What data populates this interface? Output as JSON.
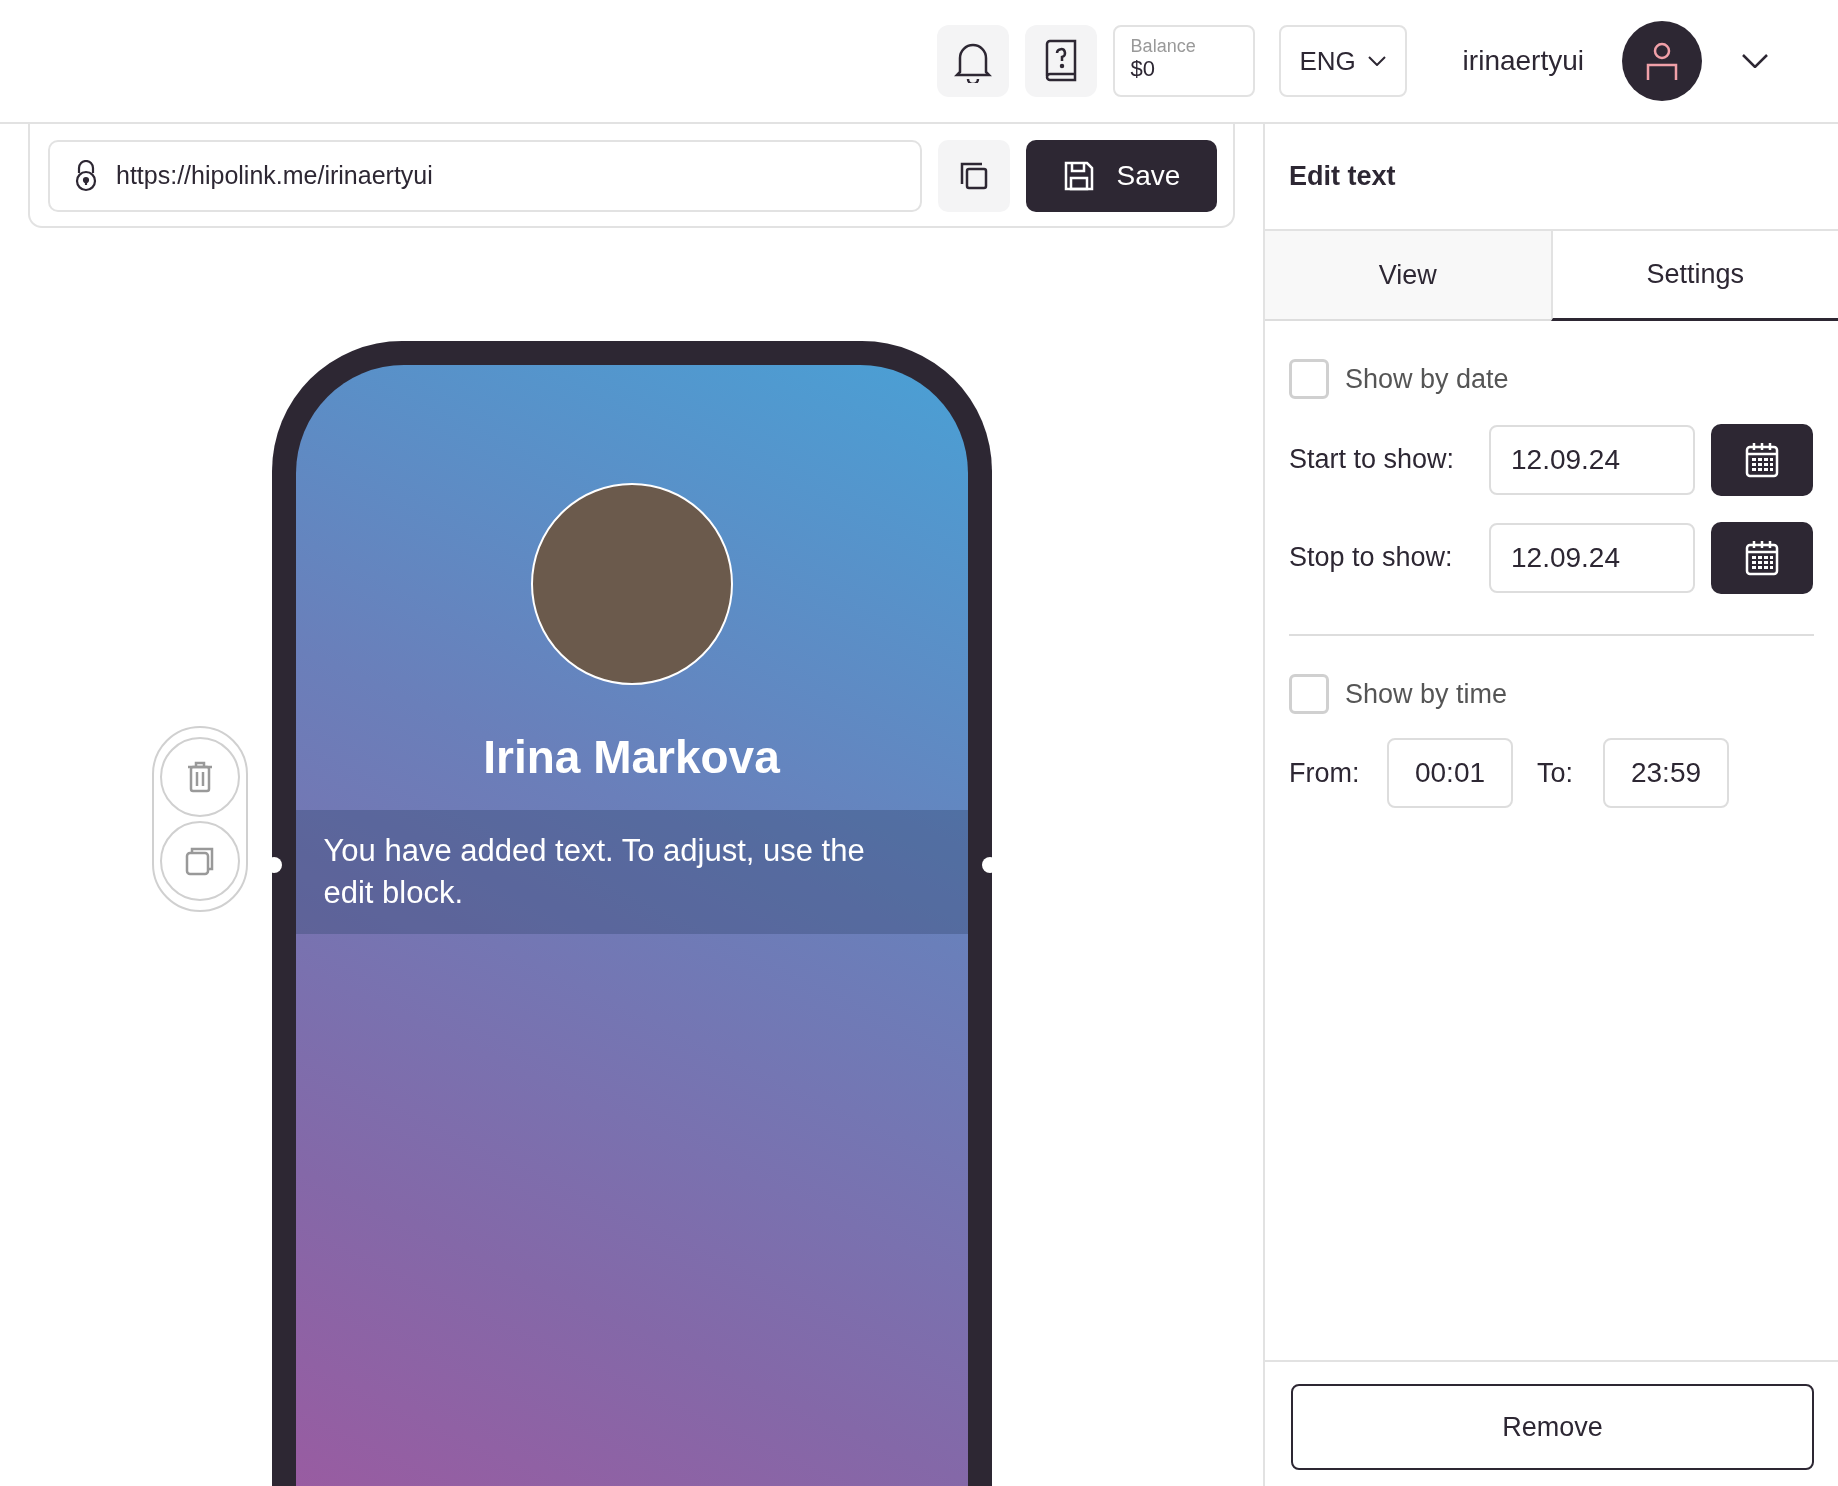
{
  "header": {
    "balance": {
      "label": "Balance",
      "value": "$0"
    },
    "language": "ENG",
    "username": "irinaertyui"
  },
  "url_bar": {
    "url": "https://hipolink.me/irinaertyui",
    "save_label": "Save"
  },
  "phone": {
    "profile_name": "Irina Markova",
    "text_block": "You have added text. To adjust, use the edit block."
  },
  "panel": {
    "title": "Edit text",
    "tabs": [
      {
        "label": "View",
        "selected": false
      },
      {
        "label": "Settings",
        "selected": true
      }
    ],
    "show_by_date": {
      "label": "Show by date",
      "checked": false
    },
    "start": {
      "label": "Start to show:",
      "value": "12.09.24"
    },
    "stop": {
      "label": "Stop to show:",
      "value": "12.09.24"
    },
    "show_by_time": {
      "label": "Show by time",
      "checked": false
    },
    "from": {
      "label": "From:",
      "value": "00:01"
    },
    "to": {
      "label": "To:",
      "value": "23:59"
    },
    "remove_label": "Remove"
  }
}
